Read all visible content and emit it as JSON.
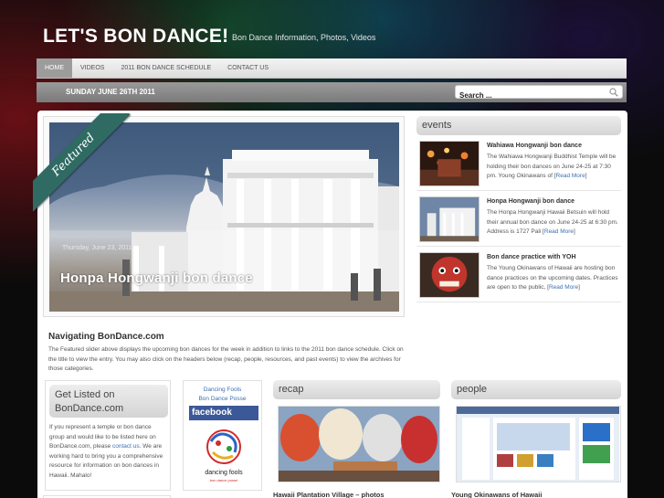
{
  "site": {
    "title": "LET'S BON DANCE!",
    "description": "Bon Dance Information, Photos, Videos"
  },
  "nav": {
    "items": [
      {
        "label": "HOME",
        "active": true
      },
      {
        "label": "VIDEOS",
        "active": false
      },
      {
        "label": "2011 BON DANCE SCHEDULE",
        "active": false
      },
      {
        "label": "CONTACT US",
        "active": false
      }
    ]
  },
  "datebar": {
    "date": "SUNDAY JUNE 26TH 2011",
    "search_placeholder": "Search ...",
    "search_icon": "search-icon"
  },
  "featured": {
    "ribbon": "Featured",
    "date": "Thursday, June 23, 2011",
    "title": "Honpa Hongwanji bon dance"
  },
  "events": {
    "heading": "events",
    "items": [
      {
        "title": "Wahiawa Hongwanji bon dance",
        "text": "The Wahiawa Hongwanji Buddhist Temple will be holding their bon dances on June 24-25 at 7:30 pm. Young Okinawans of [",
        "link": "Read More",
        "close": "]"
      },
      {
        "title": "Honpa Hongwanji bon dance",
        "text": "The Honpa Hongwanji Hawaii Betsuin will hold their annual bon dance on June 24-25 at 6:30 pm. Address is 1727 Pali [",
        "link": "Read More",
        "close": "]"
      },
      {
        "title": "Bon dance practice with YOH",
        "text": "The Young Okinawans of Hawaii are hosting bon dance practices on the upcoming dates. Practices are open to the public, [",
        "link": "Read More",
        "close": "]"
      }
    ]
  },
  "navigating": {
    "heading": "Navigating BonDance.com",
    "text": "The Featured slider above displays the upcoming bon dances for the week in addition to links to the 2011 bon dance schedule. Click on the title to view the entry. You may also click on the headers below (recap, people, resources, and past events) to view the archives for those categories."
  },
  "listed": {
    "heading": "Get Listed on BonDance.com",
    "text_before": "If you represent a temple or bon dance group and would like to be listed here on BonDance.com, please ",
    "link": "contact us",
    "text_after": ". We are working hard to bring you a comprehensive resource for information on bon dances in Hawaii. Mahalo!"
  },
  "dancing_fools": {
    "link1": "Dancing Fools",
    "link2": "Bon Dance Posse",
    "facebook": "facebook",
    "logo_text": "dancing fools",
    "logo_sub": "bon dance posse"
  },
  "recap": {
    "heading": "recap",
    "caption": "Hawaii Plantation Village – photos"
  },
  "people": {
    "heading": "people",
    "caption": "Young Okinawans of Hawaii"
  }
}
